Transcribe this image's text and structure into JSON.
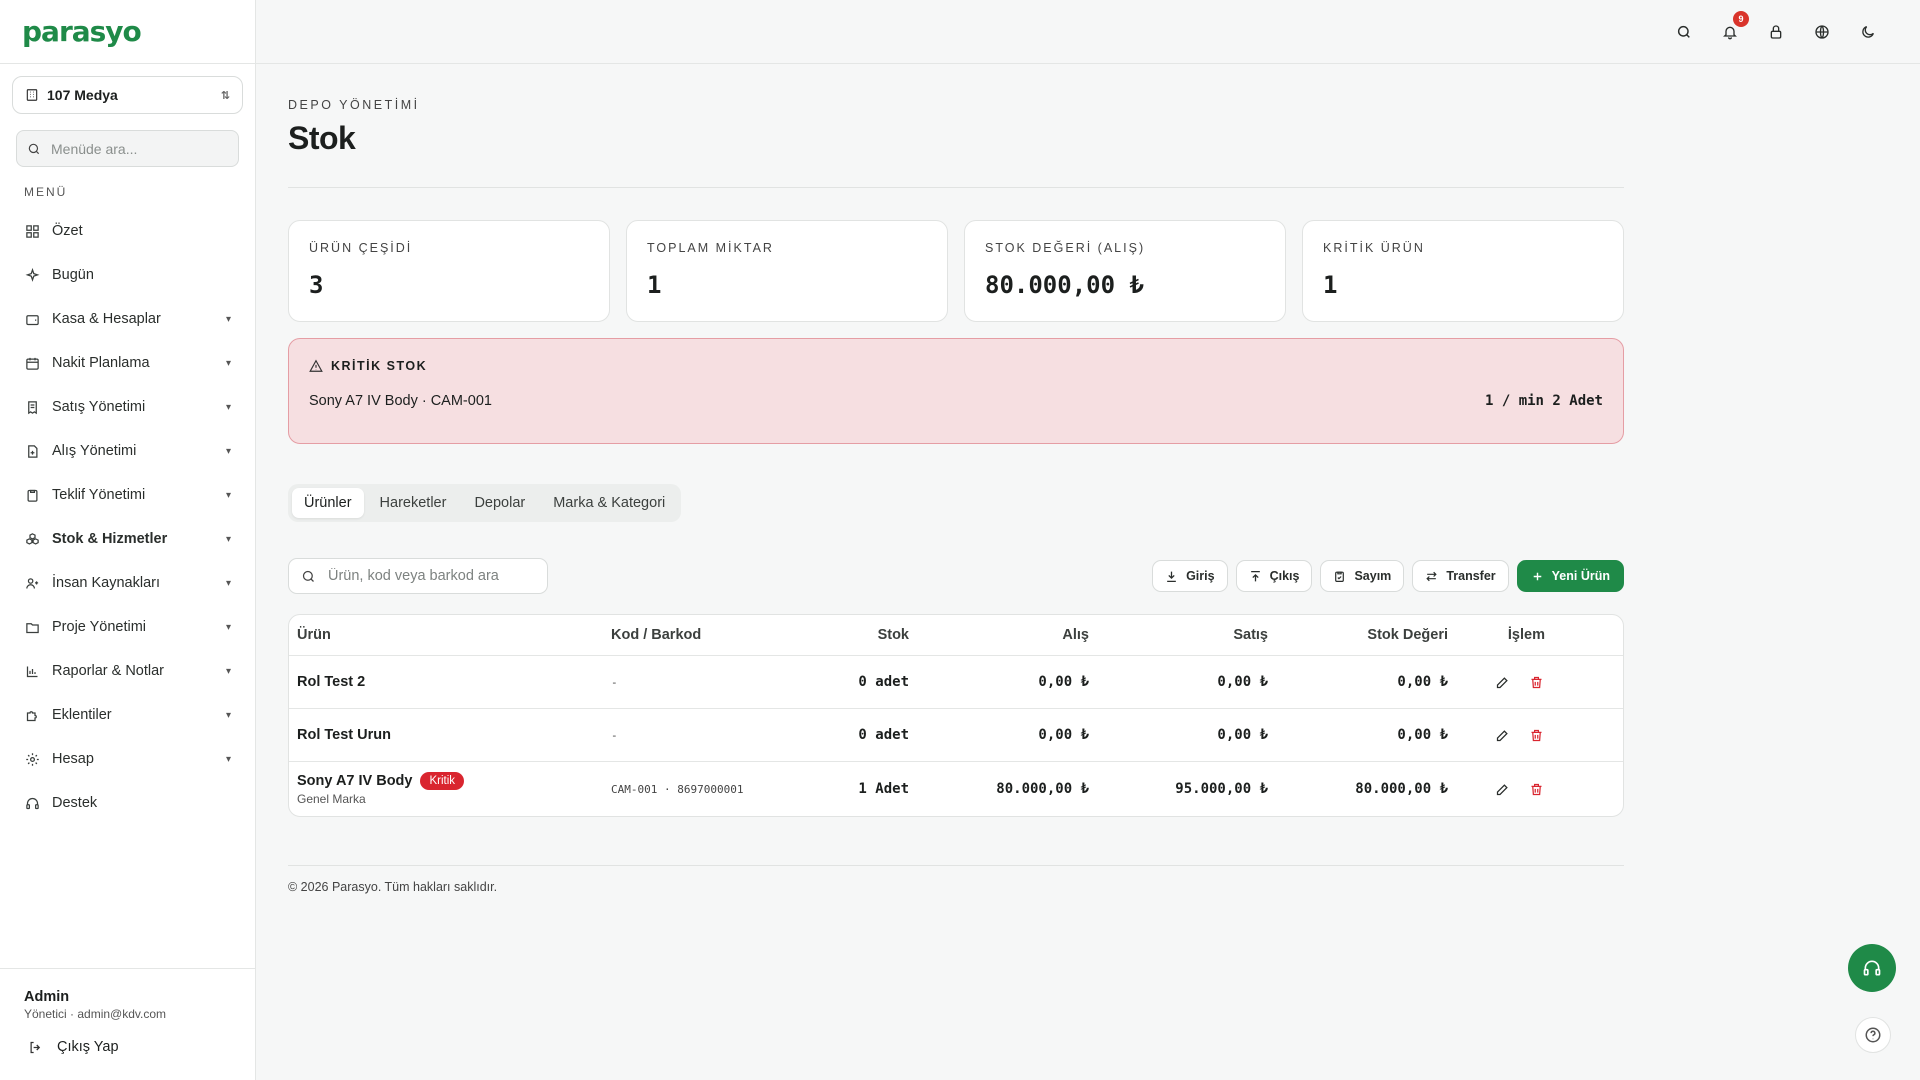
{
  "app": {
    "logo": "parasyo"
  },
  "sidebar": {
    "company": "107 Medya",
    "search_placeholder": "Menüde ara...",
    "menu_label": "MENÜ",
    "items": [
      {
        "label": "Özet",
        "icon": "grid-icon"
      },
      {
        "label": "Bugün",
        "icon": "sparkle-icon"
      },
      {
        "label": "Kasa & Hesaplar",
        "icon": "wallet-icon"
      },
      {
        "label": "Nakit Planlama",
        "icon": "calendar-icon"
      },
      {
        "label": "Satış Yönetimi",
        "icon": "receipt-icon"
      },
      {
        "label": "Alış Yönetimi",
        "icon": "file-plus-icon"
      },
      {
        "label": "Teklif Yönetimi",
        "icon": "clipboard-icon"
      },
      {
        "label": "Stok & Hizmetler",
        "icon": "boxes-icon"
      },
      {
        "label": "İnsan Kaynakları",
        "icon": "users-icon"
      },
      {
        "label": "Proje Yönetimi",
        "icon": "folder-icon"
      },
      {
        "label": "Raporlar & Notlar",
        "icon": "bar-chart-icon"
      },
      {
        "label": "Eklentiler",
        "icon": "puzzle-icon"
      },
      {
        "label": "Hesap",
        "icon": "gear-icon"
      },
      {
        "label": "Destek",
        "icon": "headset-icon"
      }
    ],
    "user": {
      "name": "Admin",
      "meta": "Yönetici · admin@kdv.com",
      "logout": "Çıkış Yap"
    }
  },
  "topbar": {
    "notification_count": "9"
  },
  "page": {
    "breadcrumb": "DEPO YÖNETİMİ",
    "title": "Stok",
    "stats": [
      {
        "label": "ÜRÜN ÇEŞİDİ",
        "value": "3"
      },
      {
        "label": "TOPLAM MİKTAR",
        "value": "1"
      },
      {
        "label": "STOK DEĞERİ (ALIŞ)",
        "value": "80.000,00 ₺"
      },
      {
        "label": "KRİTİK ÜRÜN",
        "value": "1"
      }
    ],
    "alert": {
      "title": "KRİTİK STOK",
      "item": "Sony A7 IV Body · CAM-001",
      "qty": "1 / min 2 Adet"
    },
    "tabs": [
      "Ürünler",
      "Hareketler",
      "Depolar",
      "Marka & Kategori"
    ],
    "search_placeholder": "Ürün, kod veya barkod ara",
    "actions": {
      "in": "Giriş",
      "out": "Çıkış",
      "count": "Sayım",
      "transfer": "Transfer",
      "new": "Yeni Ürün"
    },
    "table": {
      "headers": [
        "Ürün",
        "Kod / Barkod",
        "Stok",
        "Alış",
        "Satış",
        "Stok Değeri",
        "İşlem"
      ],
      "rows": [
        {
          "name": "Rol Test 2",
          "sub": "",
          "badge": "",
          "code": "-",
          "stock": "0 adet",
          "buy": "0,00 ₺",
          "sell": "0,00 ₺",
          "value": "0,00 ₺"
        },
        {
          "name": "Rol Test Urun",
          "sub": "",
          "badge": "",
          "code": "-",
          "stock": "0 adet",
          "buy": "0,00 ₺",
          "sell": "0,00 ₺",
          "value": "0,00 ₺"
        },
        {
          "name": "Sony A7 IV Body",
          "sub": "Genel Marka",
          "badge": "Kritik",
          "code": "CAM-001 · 8697000001",
          "stock": "1 Adet",
          "buy": "80.000,00 ₺",
          "sell": "95.000,00 ₺",
          "value": "80.000,00 ₺"
        }
      ]
    },
    "footer": "© 2026 Parasyo. Tüm hakları saklıdır."
  },
  "colors": {
    "brand": "#1f8a48",
    "critical": "#d9252f",
    "alert_bg": "#f6dfe1"
  }
}
